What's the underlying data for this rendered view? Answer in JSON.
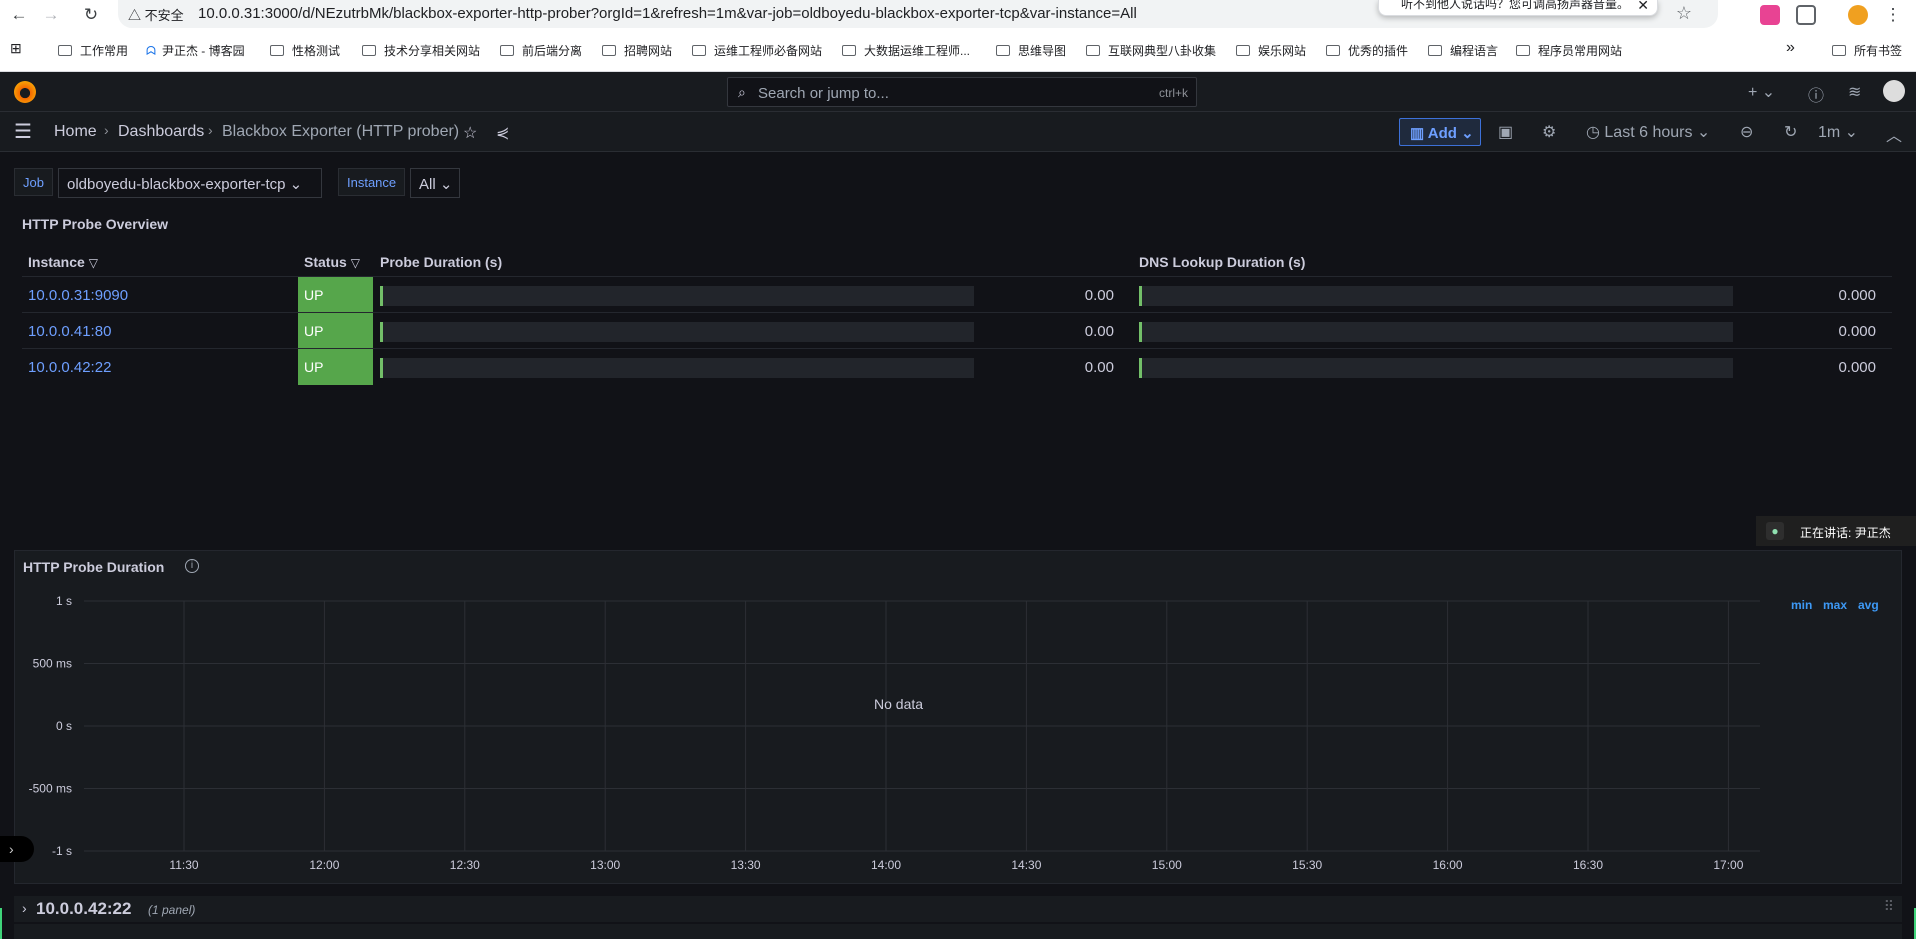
{
  "browser": {
    "back": "←",
    "forward": "→",
    "reload": "↻",
    "warning": "△ 不安全",
    "url": "10.0.0.31:3000/d/NEzutrbMk/blackbox-exporter-http-prober?orgId=1&refresh=1m&var-job=oldboyedu-blackbox-exporter-tcp&var-instance=All",
    "popup": "听不到他人说话吗？您可调高扬声器音量。",
    "popup_close": "✕",
    "star": "☆"
  },
  "bookmarks": [
    "工作常用",
    "尹正杰 - 博客园",
    "性格测试",
    "技术分享相关网站",
    "前后端分离",
    "招聘网站",
    "运维工程师必备网站",
    "大数据运维工程师...",
    "思维导图",
    "互联网典型八卦收集",
    "娱乐网站",
    "优秀的插件",
    "编程语言",
    "程序员常用网站"
  ],
  "bookmarks_more": "»",
  "bookmarks_all": "所有书签",
  "topbar": {
    "search_placeholder": "Search or jump to...",
    "shortcut": "ctrl+k",
    "plus": "+ ⌄"
  },
  "breadcrumb": {
    "home": "Home",
    "dashboards": "Dashboards",
    "current": "Blackbox Exporter (HTTP prober)"
  },
  "toolbar": {
    "add": "Add",
    "time_range": "Last 6 hours",
    "refresh_interval": "1m"
  },
  "variables": {
    "job_label": "Job",
    "job_value": "oldboyedu-blackbox-exporter-tcp",
    "instance_label": "Instance",
    "instance_value": "All"
  },
  "overview": {
    "title": "HTTP Probe Overview",
    "headers": {
      "instance": "Instance",
      "status": "Status",
      "probe": "Probe Duration (s)",
      "dns": "DNS Lookup Duration (s)"
    },
    "rows": [
      {
        "instance": "10.0.0.31:9090",
        "status": "UP",
        "probe": "0.00",
        "dns": "0.000"
      },
      {
        "instance": "10.0.0.41:80",
        "status": "UP",
        "probe": "0.00",
        "dns": "0.000"
      },
      {
        "instance": "10.0.0.42:22",
        "status": "UP",
        "probe": "0.00",
        "dns": "0.000"
      }
    ]
  },
  "speaking": {
    "label": "正在讲话:",
    "name": "尹正杰"
  },
  "graph": {
    "title": "HTTP Probe Duration",
    "no_data": "No data",
    "legend": [
      "min",
      "max",
      "avg"
    ]
  },
  "chart_data": {
    "type": "line",
    "title": "HTTP Probe Duration",
    "yticks": [
      "1 s",
      "500 ms",
      "0 s",
      "-500 ms",
      "-1 s"
    ],
    "ylim": [
      -1,
      1
    ],
    "xticks": [
      "11:30",
      "12:00",
      "12:30",
      "13:00",
      "13:30",
      "14:00",
      "14:30",
      "15:00",
      "15:30",
      "16:00",
      "16:30",
      "17:00"
    ],
    "series": [],
    "grid": true,
    "legend_placement": "right"
  },
  "collapsed_row": {
    "title": "10.0.0.42:22",
    "subtitle": "(1 panel)"
  }
}
